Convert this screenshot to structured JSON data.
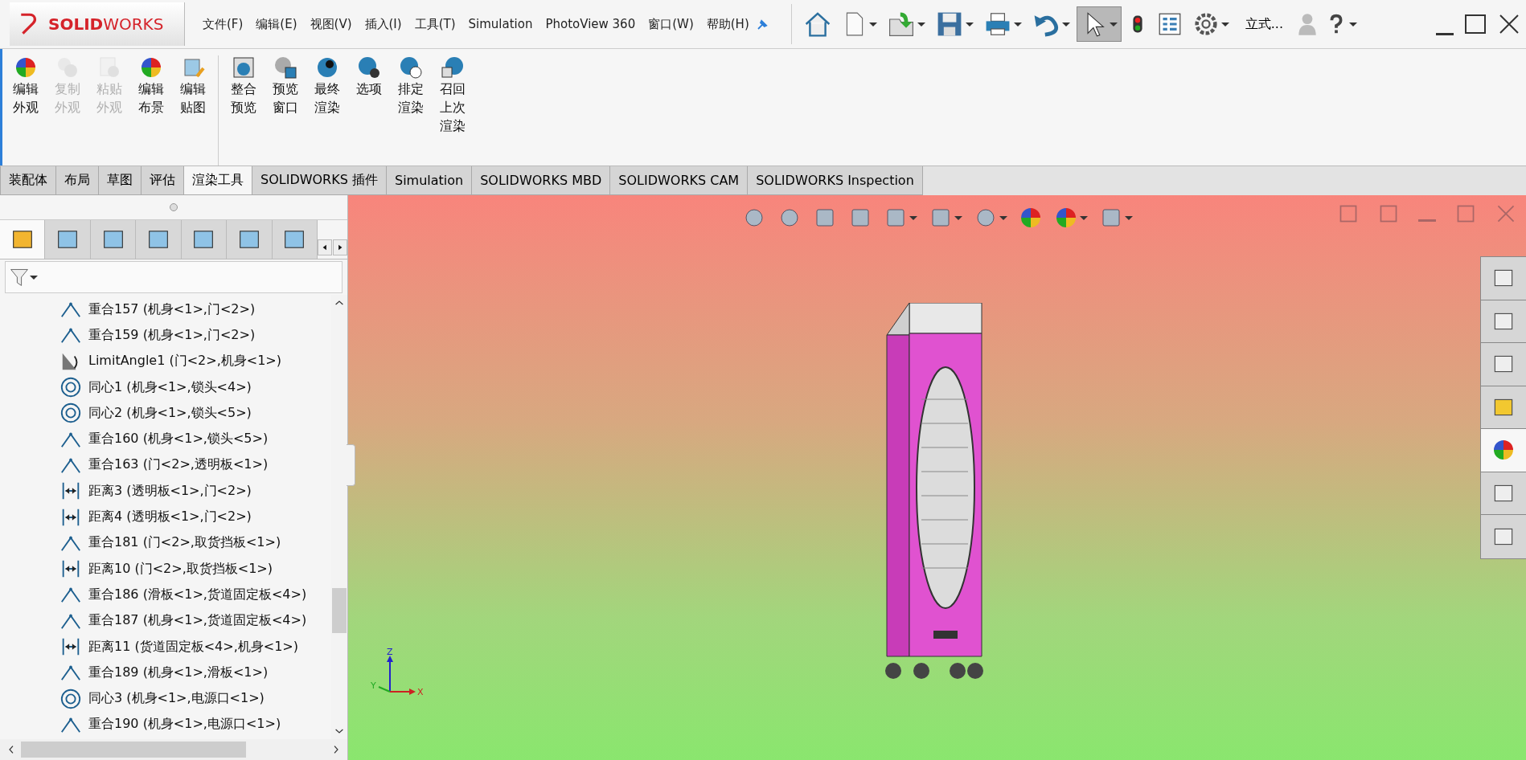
{
  "menu_bar": {
    "logo": "**SOLID**WORKS",
    "menus": [
      "文件(F)",
      "编辑(E)",
      "视图(V)",
      "插入(I)",
      "工具(T)",
      "Simulation",
      "PhotoView 360",
      "窗口(W)",
      "帮助(H)"
    ],
    "view_label": "立式..."
  },
  "ribbon": {
    "groups": [
      {
        "buttons": [
          {
            "label": "编辑外观",
            "disabled": false
          },
          {
            "label": "复制外观",
            "disabled": true
          },
          {
            "label": "粘贴外观",
            "disabled": true
          },
          {
            "label": "编辑布景",
            "disabled": false
          },
          {
            "label": "编辑贴图",
            "disabled": false
          }
        ]
      },
      {
        "buttons": [
          {
            "label": "整合预览",
            "disabled": false
          },
          {
            "label": "预览窗口",
            "disabled": false
          },
          {
            "label": "最终渲染",
            "disabled": false
          },
          {
            "label": "选项",
            "disabled": false
          },
          {
            "label": "排定渲染",
            "disabled": false
          },
          {
            "label": "召回上次渲染",
            "disabled": false
          }
        ]
      }
    ]
  },
  "command_tabs": [
    {
      "label": "装配体",
      "selected": false
    },
    {
      "label": "布局",
      "selected": false
    },
    {
      "label": "草图",
      "selected": false
    },
    {
      "label": "评估",
      "selected": false
    },
    {
      "label": "渲染工具",
      "selected": true
    },
    {
      "label": "SOLIDWORKS 插件",
      "selected": false
    },
    {
      "label": "Simulation",
      "selected": false
    },
    {
      "label": "SOLIDWORKS MBD",
      "selected": false
    },
    {
      "label": "SOLIDWORKS CAM",
      "selected": false
    },
    {
      "label": "SOLIDWORKS Inspection",
      "selected": false
    }
  ],
  "panel_tabs": [
    {
      "selected": true
    },
    {
      "selected": false
    },
    {
      "selected": false
    },
    {
      "selected": false
    },
    {
      "selected": false
    },
    {
      "selected": false
    },
    {
      "selected": false
    }
  ],
  "tree": [
    {
      "kind": "coincident",
      "label": "重合157 (机身<1>,门<2>)"
    },
    {
      "kind": "coincident",
      "label": "重合159 (机身<1>,门<2>)"
    },
    {
      "kind": "limit-angle",
      "label": "LimitAngle1 (门<2>,机身<1>)"
    },
    {
      "kind": "concentric",
      "label": "同心1 (机身<1>,锁头<4>)"
    },
    {
      "kind": "concentric",
      "label": "同心2 (机身<1>,锁头<5>)"
    },
    {
      "kind": "coincident",
      "label": "重合160 (机身<1>,锁头<5>)"
    },
    {
      "kind": "coincident",
      "label": "重合163 (门<2>,透明板<1>)"
    },
    {
      "kind": "distance",
      "label": "距离3 (透明板<1>,门<2>)"
    },
    {
      "kind": "distance",
      "label": "距离4 (透明板<1>,门<2>)"
    },
    {
      "kind": "coincident",
      "label": "重合181 (门<2>,取货挡板<1>)"
    },
    {
      "kind": "distance",
      "label": "距离10 (门<2>,取货挡板<1>)"
    },
    {
      "kind": "coincident",
      "label": "重合186 (滑板<1>,货道固定板<4>)"
    },
    {
      "kind": "coincident",
      "label": "重合187 (机身<1>,货道固定板<4>)"
    },
    {
      "kind": "distance",
      "label": "距离11 (货道固定板<4>,机身<1>)"
    },
    {
      "kind": "coincident",
      "label": "重合189 (机身<1>,滑板<1>)"
    },
    {
      "kind": "concentric",
      "label": "同心3 (机身<1>,电源口<1>)"
    },
    {
      "kind": "coincident",
      "label": "重合190 (机身<1>,电源口<1>)"
    }
  ],
  "task_pane": [
    {
      "selected": false
    },
    {
      "selected": false
    },
    {
      "selected": false
    },
    {
      "selected": false
    },
    {
      "selected": true
    },
    {
      "selected": false
    },
    {
      "selected": false
    }
  ],
  "triad": {
    "x": "X",
    "y": "Y",
    "z": "Z"
  }
}
